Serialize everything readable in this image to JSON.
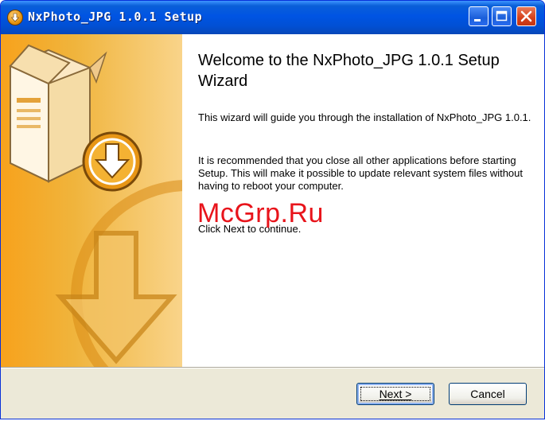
{
  "window": {
    "title": "NxPhoto_JPG 1.0.1 Setup",
    "colors": {
      "titlebar": "#0054e3",
      "side_panel": "#f7a21c",
      "close_button": "#d6401a"
    }
  },
  "content": {
    "heading": "Welcome to the NxPhoto_JPG 1.0.1 Setup Wizard",
    "paragraph1": "This wizard will guide you through the installation of NxPhoto_JPG 1.0.1.",
    "paragraph2": "It is recommended that you close all other applications before starting Setup. This will make it possible to update relevant system files without having to reboot your computer.",
    "paragraph3": "Click Next to continue.",
    "watermark": "McGrp.Ru"
  },
  "icons": {
    "window": "installer-icon",
    "minimize": "minimize-icon",
    "maximize": "maximize-icon",
    "close": "close-icon",
    "wizard_graphic": "software-box-download-icon"
  },
  "buttons": {
    "next": "Next >",
    "cancel": "Cancel"
  }
}
